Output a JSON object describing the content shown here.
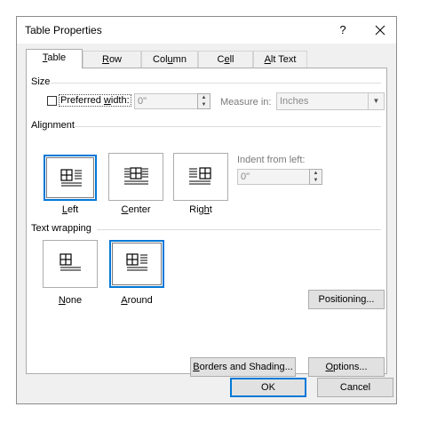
{
  "window": {
    "title": "Table Properties",
    "help_label": "?"
  },
  "tabs": [
    {
      "label": "Table",
      "hotkey": "T",
      "rest": "able"
    },
    {
      "label": "Row",
      "hotkey": "R",
      "rest": "ow"
    },
    {
      "label": "Column",
      "hotkey": "U",
      "pre": "Col",
      "rest": "mn"
    },
    {
      "label": "Cell",
      "hotkey": "E",
      "pre": "C",
      "rest": "ll"
    },
    {
      "label": "Alt Text",
      "hotkey": "A",
      "rest": "lt Text"
    }
  ],
  "size": {
    "heading": "Size",
    "preferred_width_checked": false,
    "preferred_width_pre": "Preferred ",
    "preferred_width_hotkey": "w",
    "preferred_width_post": "idth:",
    "width_value": "0\"",
    "measure_label": "Measure in:",
    "measure_value": "Inches"
  },
  "alignment": {
    "heading": "Alignment",
    "options": [
      {
        "label": "Left",
        "hotkey": "L",
        "rest": "eft",
        "selected": true
      },
      {
        "label": "Center",
        "hotkey": "C",
        "rest": "enter",
        "selected": false
      },
      {
        "label": "Right",
        "hotkey": "h",
        "pre": "Rig",
        "rest": "t",
        "selected": false
      }
    ],
    "indent_label": "Indent from left:",
    "indent_value": "0\""
  },
  "text_wrapping": {
    "heading": "Text wrapping",
    "options": [
      {
        "label": "None",
        "hotkey": "N",
        "rest": "one",
        "selected": false
      },
      {
        "label": "Around",
        "hotkey": "A",
        "rest": "round",
        "selected": true
      }
    ],
    "positioning_label": "Positioning..."
  },
  "buttons": {
    "borders_pre": "",
    "borders_hotkey": "B",
    "borders_rest": "orders and Shading...",
    "options_hotkey": "O",
    "options_rest": "ptions...",
    "ok": "OK",
    "cancel": "Cancel"
  },
  "colors": {
    "accent": "#0078d7",
    "dialog_bg": "#f0f0f0",
    "panel_bg": "#ffffff"
  }
}
